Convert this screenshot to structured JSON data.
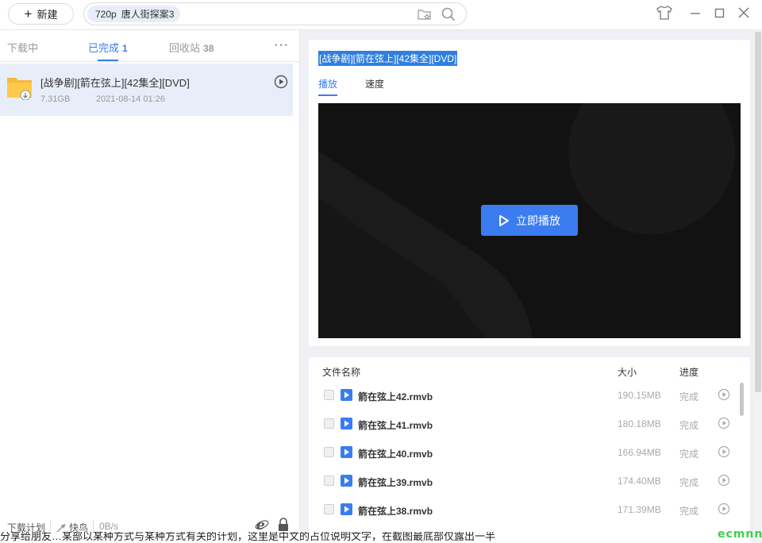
{
  "toolbar": {
    "new_label": "新建",
    "search_chip_quality": "720p",
    "search_chip_title": "唐人街探案3"
  },
  "left_panel": {
    "tabs": [
      {
        "label": "下载中",
        "count": ""
      },
      {
        "label": "已完成",
        "count": "1"
      },
      {
        "label": "回收站",
        "count": "38"
      }
    ],
    "more_label": "···",
    "item": {
      "title": "[战争剧][箭在弦上][42集全][DVD]",
      "size": "7.31GB",
      "date": "2021-08-14 01:26"
    },
    "footer": {
      "plan_label": "下载计划",
      "kuainiao_label": "快鸟",
      "speed": "0B/s"
    },
    "bottom_strip_text": "分享给朋友…某部以某种方式与某种方式有关的计划，这里是中文的占位说明文字，在截图最底部仅露出一半"
  },
  "detail": {
    "title": "[战争剧][箭在弦上][42集全][DVD]",
    "tabs": [
      "播放",
      "速度"
    ],
    "play_button_label": "立即播放"
  },
  "files": {
    "headers": {
      "name": "文件名称",
      "size": "大小",
      "progress": "进度"
    },
    "rows": [
      {
        "name": "箭在弦上42.rmvb",
        "size": "190.15MB",
        "progress": "完成"
      },
      {
        "name": "箭在弦上41.rmvb",
        "size": "180.18MB",
        "progress": "完成"
      },
      {
        "name": "箭在弦上40.rmvb",
        "size": "166.94MB",
        "progress": "完成"
      },
      {
        "name": "箭在弦上39.rmvb",
        "size": "174.40MB",
        "progress": "完成"
      },
      {
        "name": "箭在弦上38.rmvb",
        "size": "171.39MB",
        "progress": "完成"
      }
    ]
  },
  "watermark": "ecmnn",
  "colors": {
    "accent": "#3b7cf0",
    "video_bg": "#121212",
    "selected_row": "#e8eef9"
  }
}
